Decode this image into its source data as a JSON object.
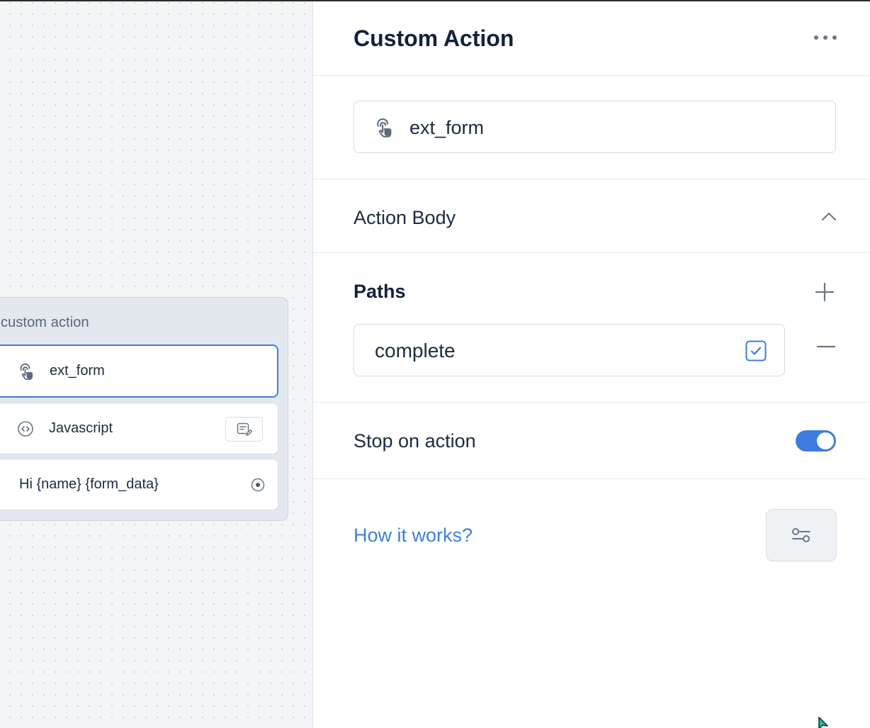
{
  "canvas": {
    "node": {
      "title": "custom action",
      "steps": [
        {
          "label": "ext_form",
          "icon": "tap-icon",
          "selected": true
        },
        {
          "label": "Javascript",
          "icon": "code-icon",
          "action_icon": "edit-code-icon"
        },
        {
          "label": "Hi {name} {form_data}",
          "action_icon": "port-icon"
        }
      ]
    }
  },
  "panel": {
    "title": "Custom Action",
    "menu_icon": "more-horizontal-icon",
    "action_name": {
      "value": "ext_form",
      "icon": "tap-icon"
    },
    "action_body": {
      "label": "Action Body",
      "icon": "chevron-up-icon"
    },
    "paths": {
      "title": "Paths",
      "add_icon": "plus-icon",
      "items": [
        {
          "value": "complete",
          "check_icon": "check-square-icon",
          "remove_icon": "minus-icon"
        }
      ]
    },
    "stop_on_action": {
      "label": "Stop on action",
      "enabled": true
    },
    "help": {
      "label": "How it works?",
      "settings_icon": "sliders-icon"
    }
  },
  "colors": {
    "accent": "#3d7be0",
    "link": "#3d7fd9",
    "canvas_bg": "#f3f5f7",
    "node_bg": "#e2e8ee",
    "text_dark": "#14213a"
  }
}
